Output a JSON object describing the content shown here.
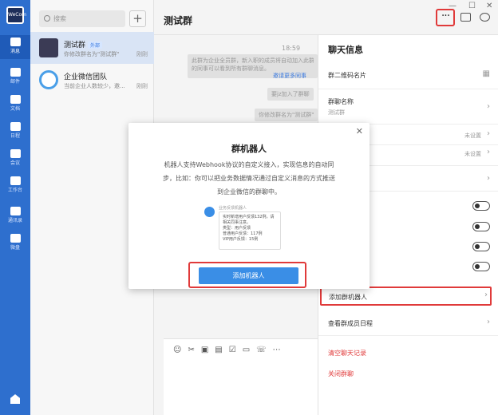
{
  "nav": {
    "logo": "WeCom",
    "items": [
      {
        "label": "消息",
        "icon": "chat-icon"
      },
      {
        "label": "邮件",
        "icon": "mail-icon"
      },
      {
        "label": "文档",
        "icon": "document-icon"
      },
      {
        "label": "日程",
        "icon": "calendar-icon"
      },
      {
        "label": "会议",
        "icon": "meeting-icon"
      },
      {
        "label": "工作台",
        "icon": "workbench-icon"
      },
      {
        "label": "通讯录",
        "icon": "contacts-icon"
      },
      {
        "label": "微盘",
        "icon": "drive-icon"
      }
    ]
  },
  "list": {
    "search_placeholder": "搜索",
    "conversations": [
      {
        "name": "测试群",
        "tag": "外部",
        "sub": "你修改群名为\"测试群\"",
        "time": "刚刚"
      },
      {
        "name": "企业微信团队",
        "tag": "",
        "sub": "当前企业人数较少，邀...",
        "time": "刚刚"
      }
    ]
  },
  "chat": {
    "title": "测试群",
    "time": "18:59",
    "sys1_line1": "此群为企业全员群，新入职的成员将自动加入此群",
    "sys1_line2": "的同事可以看到所有群聊消息。",
    "sys1_link": "邀请更多同事",
    "sys2": "要jz加入了群聊",
    "sys3": "你修改群名为\"测试群\""
  },
  "side": {
    "title": "聊天信息",
    "qr_label": "群二维码名片",
    "name_label": "群聊名称",
    "name_value": "测试群",
    "unset1": "未设置",
    "unset2": "未设置",
    "add_bot": "添加群机器人",
    "schedule": "查看群成员日程",
    "clear": "清空聊天记录",
    "close": "关闭群聊"
  },
  "modal": {
    "title": "群机器人",
    "desc": "机器人支持Webhook协议的自定义接入，实现信息的自动同步，比如：你可以把业务数据情况通过自定义消息的方式推送到企业微信的群聊中。",
    "preview_name": "业务反馈机器人",
    "preview_l1": "实时新增用户反馈132例，请相关同事注意。",
    "preview_l2": "类型：用户反馈",
    "preview_l3": "普通用户反馈：117例",
    "preview_l4": "VIP用户反馈：15例",
    "button": "添加机器人"
  },
  "colors": {
    "accent": "#3a8ee6",
    "nav": "#2e6fce",
    "highlight": "#e03a3a"
  }
}
